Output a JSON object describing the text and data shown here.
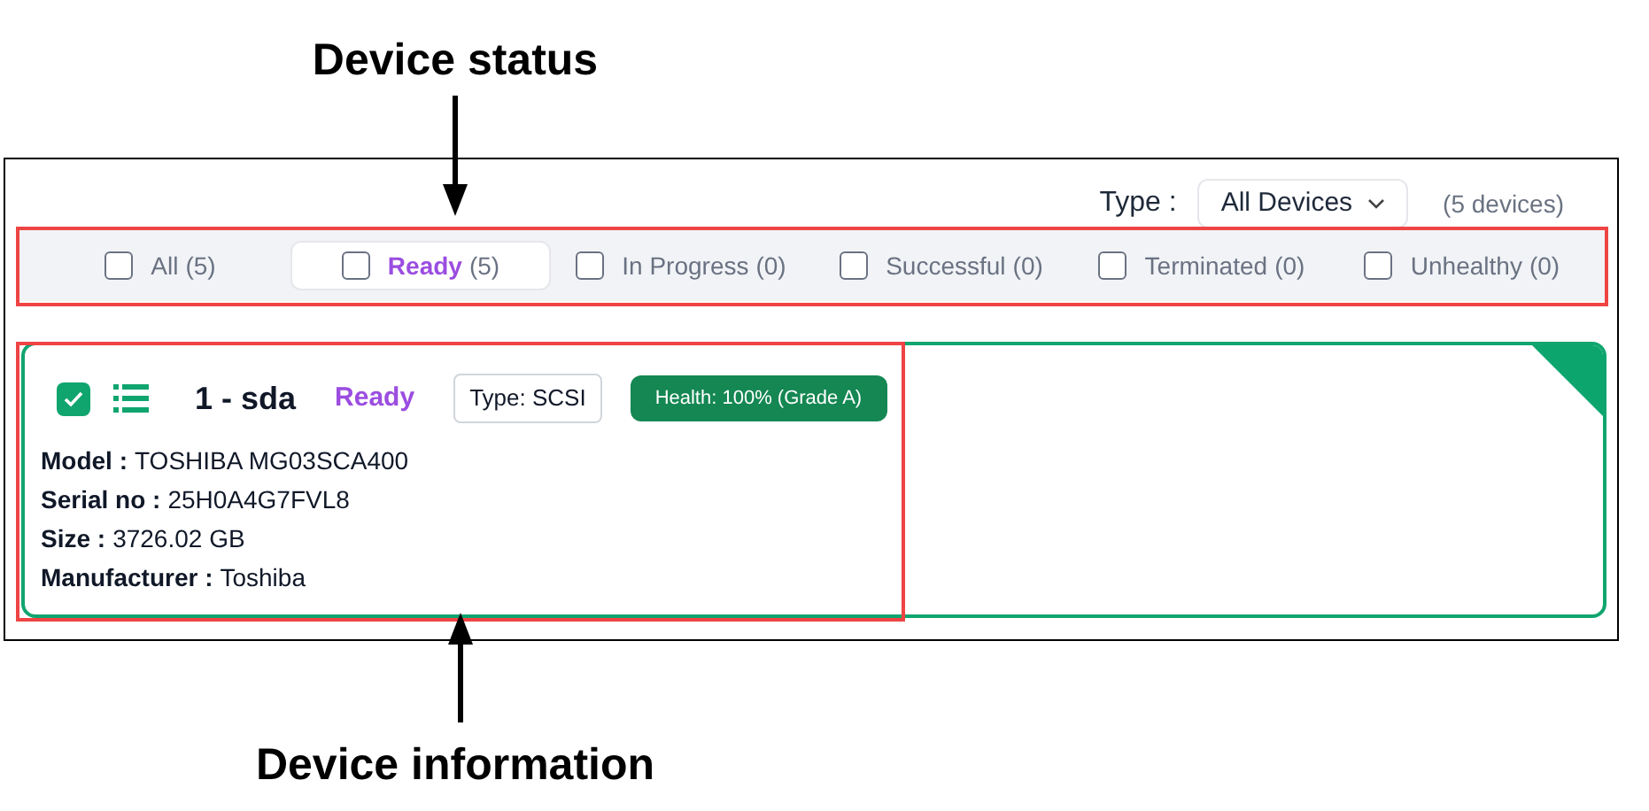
{
  "annotations": [
    {
      "kind": "top",
      "text": "Device status"
    },
    {
      "kind": "bottom",
      "text": "Device information"
    }
  ],
  "type_filter": {
    "label": "Type :",
    "value": "All Devices"
  },
  "device_count": "(5 devices)",
  "status_tabs": [
    {
      "label": "All",
      "count": "(5)",
      "selected": false
    },
    {
      "label": "Ready",
      "count": "(5)",
      "selected": true
    },
    {
      "label": "In Progress",
      "count": "(0)",
      "selected": false
    },
    {
      "label": "Successful",
      "count": "(0)",
      "selected": false
    },
    {
      "label": "Terminated",
      "count": "(0)",
      "selected": false
    },
    {
      "label": "Unhealthy",
      "count": "(0)",
      "selected": false
    }
  ],
  "device": {
    "checked": true,
    "name": "1 - sda",
    "status": "Ready",
    "type": "Type: SCSI",
    "health": "Health: 100% (Grade A)",
    "fields": [
      {
        "label": "Model :",
        "value": "TOSHIBA MG03SCA400"
      },
      {
        "label": "Serial no :",
        "value": "25H0A4G7FVL8"
      },
      {
        "label": "Size :",
        "value": "3726.02 GB"
      },
      {
        "label": "Manufacturer :",
        "value": "Toshiba"
      }
    ]
  }
}
